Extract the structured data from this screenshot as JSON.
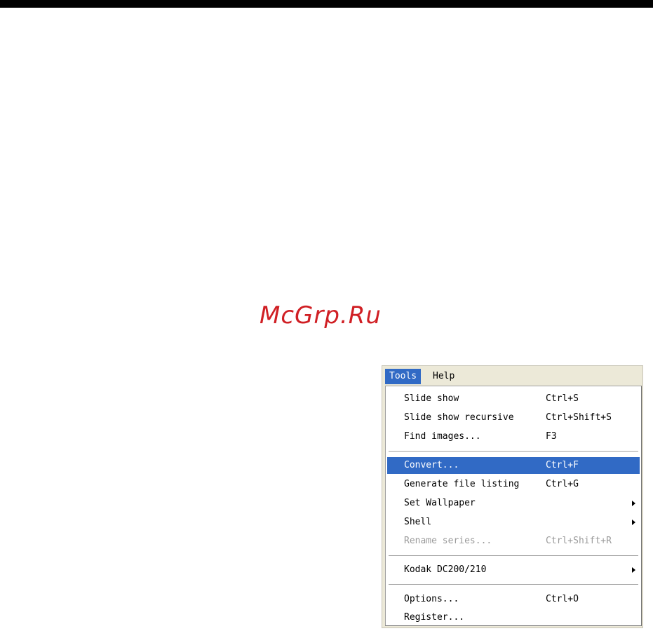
{
  "watermark": "McGrp.Ru",
  "menubar": {
    "tools": "Tools",
    "help": "Help"
  },
  "menu": {
    "slide_show": {
      "label": "Slide show",
      "shortcut": "Ctrl+S"
    },
    "slide_show_recursive": {
      "label": "Slide show recursive",
      "shortcut": "Ctrl+Shift+S"
    },
    "find_images": {
      "label": "Find images...",
      "shortcut": "F3"
    },
    "convert": {
      "label": "Convert...",
      "shortcut": "Ctrl+F"
    },
    "generate_file_listing": {
      "label": "Generate file listing",
      "shortcut": "Ctrl+G"
    },
    "set_wallpaper": {
      "label": "Set Wallpaper"
    },
    "shell": {
      "label": "Shell"
    },
    "rename_series": {
      "label": "Rename series...",
      "shortcut": "Ctrl+Shift+R"
    },
    "kodak": {
      "label": "Kodak DC200/210"
    },
    "options": {
      "label": "Options...",
      "shortcut": "Ctrl+O"
    },
    "register": {
      "label": "Register..."
    }
  },
  "colors": {
    "highlight": "#316ac5",
    "watermark": "#d01f24",
    "menubar_bg": "#ece9d8",
    "disabled_text": "#9a9a9a"
  },
  "icons": {
    "submenu_arrow": "chevron-right-icon"
  }
}
